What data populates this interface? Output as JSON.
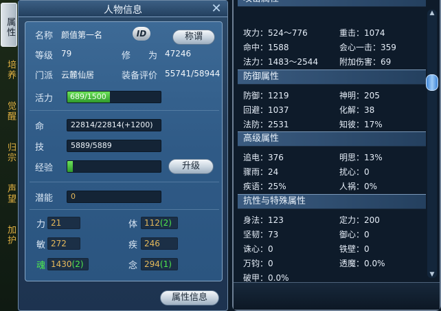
{
  "side_tabs": [
    "属性",
    "培养",
    "觉醒",
    "归宗",
    "声望",
    "加护"
  ],
  "panel": {
    "title": "人物信息",
    "close_label": "✕",
    "name_label": "名称",
    "name_value": "颜值第一名",
    "id_badge": "ID",
    "title_button": "称谓",
    "level_label": "等级",
    "level_value": "79",
    "cultivation_label": "修　　为",
    "cultivation_value": "47246",
    "sect_label": "门派",
    "sect_value": "云麓仙居",
    "equip_label": "装备评价",
    "equip_value": "55741/58944",
    "vitality_label": "活力",
    "vitality_value": "689/1500",
    "vitality_fraction": 0.459,
    "life_label": "命",
    "life_value": "22814/22814(+1200)",
    "skill_label": "技",
    "skill_value": "5889/5889",
    "exp_label": "经验",
    "exp_fraction": 0.06,
    "upgrade_button": "升级",
    "potential_label": "潜能",
    "potential_value": "0",
    "stats": [
      {
        "label": "力",
        "value": "21",
        "bonus": ""
      },
      {
        "label": "体",
        "value": "112",
        "bonus": "(2)"
      },
      {
        "label": "敏",
        "value": "272",
        "bonus": ""
      },
      {
        "label": "疾",
        "value": "246",
        "bonus": ""
      },
      {
        "label": "魂",
        "value": "1430",
        "bonus": "(2)"
      },
      {
        "label": "念",
        "value": "294",
        "bonus": "(1)"
      }
    ],
    "attr_info_button": "属性信息"
  },
  "attributes": {
    "top_partial_header": "攻击属性",
    "attack_rows": [
      [
        "攻力：524～776",
        "重击：1074"
      ],
      [
        "命中：1588",
        "会心一击：359"
      ],
      [
        "法力：1483～2544",
        "附加伤害：69"
      ]
    ],
    "defense_header": "防御属性",
    "defense_rows": [
      [
        "防御：1219",
        "神明：205"
      ],
      [
        "回避：1037",
        "化解：38"
      ],
      [
        "法防：2531",
        "知彼：17%"
      ]
    ],
    "advanced_header": "高级属性",
    "advanced_rows": [
      [
        "追电：376",
        "明思：13%"
      ],
      [
        "骤雨：24",
        "扰心：0"
      ],
      [
        "疾语：25%",
        "人祸：0%"
      ]
    ],
    "resist_header": "抗性与特殊属性",
    "resist_rows": [
      [
        "身法：123",
        "定力：200"
      ],
      [
        "坚韧：73",
        "御心：0"
      ],
      [
        "诛心：0",
        "铁壁：0"
      ],
      [
        "万钧：0",
        "透魔：0.0%"
      ],
      [
        "破甲：0.0%",
        ""
      ]
    ]
  },
  "colors": {
    "accent_gold": "#e2b243",
    "bonus_green": "#4fe84c",
    "bar_green": "#3fbf36"
  }
}
